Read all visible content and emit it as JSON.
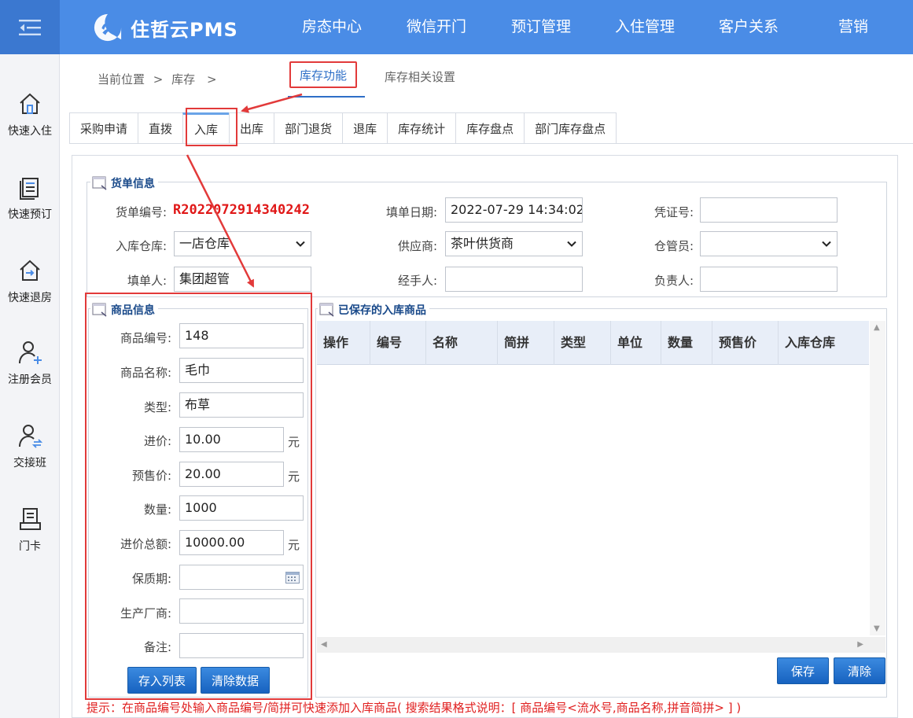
{
  "topbar": {
    "brand": "住哲云PMS",
    "nav": [
      "房态中心",
      "微信开门",
      "预订管理",
      "入住管理",
      "客户关系",
      "营销"
    ]
  },
  "sidebar": {
    "items": [
      {
        "label": "快速入住",
        "icon": "home-icon"
      },
      {
        "label": "快速预订",
        "icon": "document-list-icon"
      },
      {
        "label": "快速退房",
        "icon": "checkout-house-icon"
      },
      {
        "label": "注册会员",
        "icon": "add-user-icon"
      },
      {
        "label": "交接班",
        "icon": "handover-user-icon"
      },
      {
        "label": "门卡",
        "icon": "card-icon"
      }
    ]
  },
  "breadcrumb": {
    "prefix": "当前位置",
    "sep1": ">",
    "current": "库存",
    "sep2": ">"
  },
  "function_tabs": {
    "active": "库存功能",
    "other": "库存相关设置"
  },
  "sub_tabs": [
    "采购申请",
    "直拨",
    "入库",
    "出库",
    "部门退货",
    "退库",
    "库存统计",
    "库存盘点",
    "部门库存盘点"
  ],
  "bill_info": {
    "legend": "货单信息",
    "bill_no_label": "货单编号:",
    "bill_no": "R2022072914340242",
    "date_label": "填单日期:",
    "date": "2022-07-29 14:34:02",
    "voucher_label": "凭证号:",
    "voucher": "",
    "warehouse_label": "入库仓库:",
    "warehouse": "一店仓库",
    "supplier_label": "供应商:",
    "supplier": "茶叶供货商",
    "keeper_label": "仓管员:",
    "keeper": "",
    "filler_label": "填单人:",
    "filler": "集团超管",
    "handler_label": "经手人:",
    "handler": "",
    "owner_label": "负责人:",
    "owner": ""
  },
  "goods_info": {
    "legend": "商品信息",
    "fields": {
      "code_label": "商品编号:",
      "code": "148",
      "name_label": "商品名称:",
      "name": "毛巾",
      "type_label": "类型:",
      "type": "布草",
      "cost_label": "进价:",
      "cost": "10.00",
      "presale_label": "预售价:",
      "presale": "20.00",
      "qty_label": "数量:",
      "qty": "1000",
      "total_label": "进价总额:",
      "total": "10000.00",
      "shelf_label": "保质期:",
      "shelf": "",
      "maker_label": "生产厂商:",
      "maker": "",
      "note_label": "备注:",
      "note": ""
    },
    "unit": "元",
    "btn_add": "存入列表",
    "btn_clear": "清除数据"
  },
  "saved_goods": {
    "legend": "已保存的入库商品",
    "columns": [
      "操作",
      "编号",
      "名称",
      "简拼",
      "类型",
      "单位",
      "数量",
      "预售价",
      "入库仓库"
    ],
    "rows": [],
    "btn_save": "保存",
    "btn_clear": "清除"
  },
  "tip": "提示：在商品编号处输入商品编号/简拼可快速添加入库商品( 搜索结果格式说明：[ 商品编号<流水号,商品名称,拼音简拼> ] )",
  "colors": {
    "brand_blue": "#4a8ce6",
    "highlight_red": "#e23a3a"
  }
}
